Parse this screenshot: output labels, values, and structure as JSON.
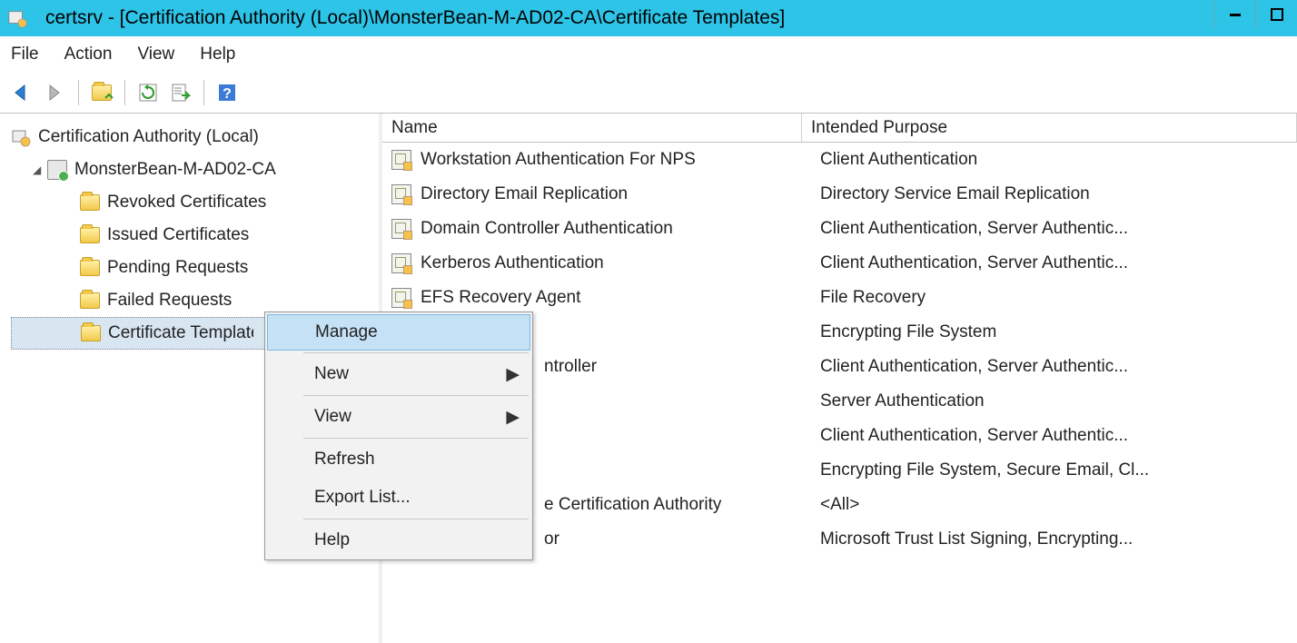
{
  "titlebar": {
    "title": "certsrv - [Certification Authority (Local)\\MonsterBean-M-AD02-CA\\Certificate Templates]"
  },
  "menubar": {
    "file": "File",
    "action": "Action",
    "view": "View",
    "help": "Help"
  },
  "tree": {
    "root": "Certification Authority (Local)",
    "ca": "MonsterBean-M-AD02-CA",
    "nodes": {
      "revoked": "Revoked Certificates",
      "issued": "Issued Certificates",
      "pending": "Pending Requests",
      "failed": "Failed Requests",
      "templates": "Certificate Templates"
    }
  },
  "columns": {
    "name": "Name",
    "purpose": "Intended Purpose"
  },
  "rows": [
    {
      "name": "Workstation Authentication For NPS",
      "purpose": "Client Authentication"
    },
    {
      "name": "Directory Email Replication",
      "purpose": "Directory Service Email Replication"
    },
    {
      "name": "Domain Controller Authentication",
      "purpose": "Client Authentication, Server Authentic..."
    },
    {
      "name": "Kerberos Authentication",
      "purpose": "Client Authentication, Server Authentic..."
    },
    {
      "name": "EFS Recovery Agent",
      "purpose": "File Recovery"
    },
    {
      "name": "",
      "purpose": "Encrypting File System"
    },
    {
      "name": "ntroller",
      "purpose": "Client Authentication, Server Authentic..."
    },
    {
      "name": "",
      "purpose": "Server Authentication"
    },
    {
      "name": "",
      "purpose": "Client Authentication, Server Authentic..."
    },
    {
      "name": "",
      "purpose": "Encrypting File System, Secure Email, Cl..."
    },
    {
      "name": "e Certification Authority",
      "purpose": "<All>"
    },
    {
      "name": "or",
      "purpose": "Microsoft Trust List Signing, Encrypting..."
    }
  ],
  "contextmenu": {
    "manage": "Manage",
    "new": "New",
    "view": "View",
    "refresh": "Refresh",
    "export": "Export List...",
    "help": "Help"
  }
}
